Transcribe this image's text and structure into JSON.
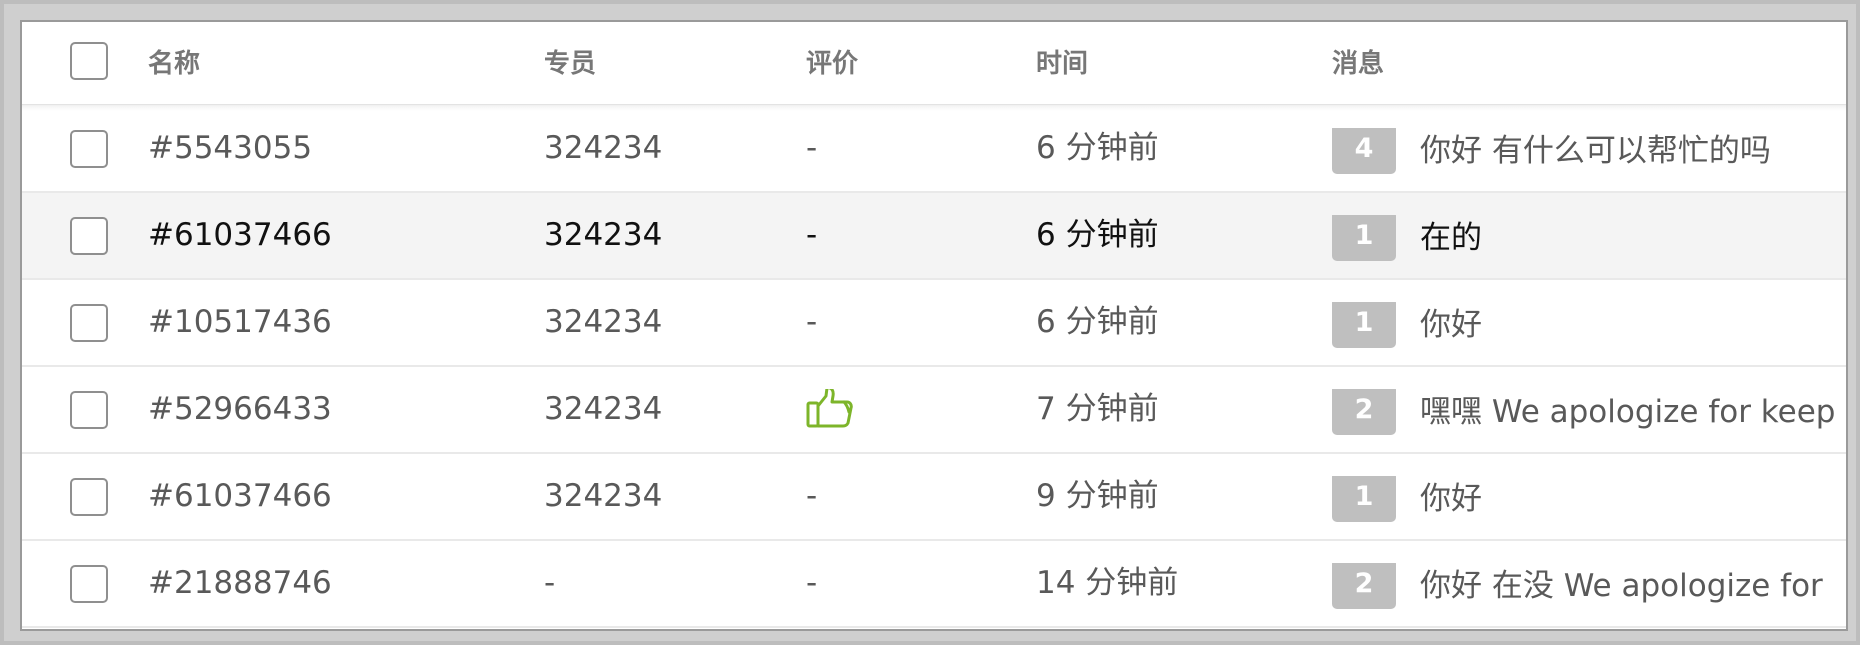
{
  "table": {
    "columns": {
      "name": "名称",
      "agent": "专员",
      "rating": "评价",
      "time": "时间",
      "message": "消息"
    },
    "rows": [
      {
        "name": "#5543055",
        "agent": "324234",
        "rating": "-",
        "time": "6 分钟前",
        "count": "4",
        "message": "你好 有什么可以帮忙的吗"
      },
      {
        "name": "#61037466",
        "agent": "324234",
        "rating": "-",
        "time": "6 分钟前",
        "count": "1",
        "message": "在的"
      },
      {
        "name": "#10517436",
        "agent": "324234",
        "rating": "-",
        "time": "6 分钟前",
        "count": "1",
        "message": "你好"
      },
      {
        "name": "#52966433",
        "agent": "324234",
        "rating_icon": "thumbs-up-icon",
        "time": "7 分钟前",
        "count": "2",
        "message": "嘿嘿 We apologize for keep"
      },
      {
        "name": "#61037466",
        "agent": "324234",
        "rating": "-",
        "time": "9 分钟前",
        "count": "1",
        "message": "你好"
      },
      {
        "name": "#21888746",
        "agent": "-",
        "rating": "-",
        "time": "14 分钟前",
        "count": "2",
        "message": "你好 在没 We apologize for"
      }
    ]
  },
  "colors": {
    "badge": "#bfbfbf",
    "thumb_icon": "#7db52a",
    "highlight_row": "#f4f4f4"
  }
}
